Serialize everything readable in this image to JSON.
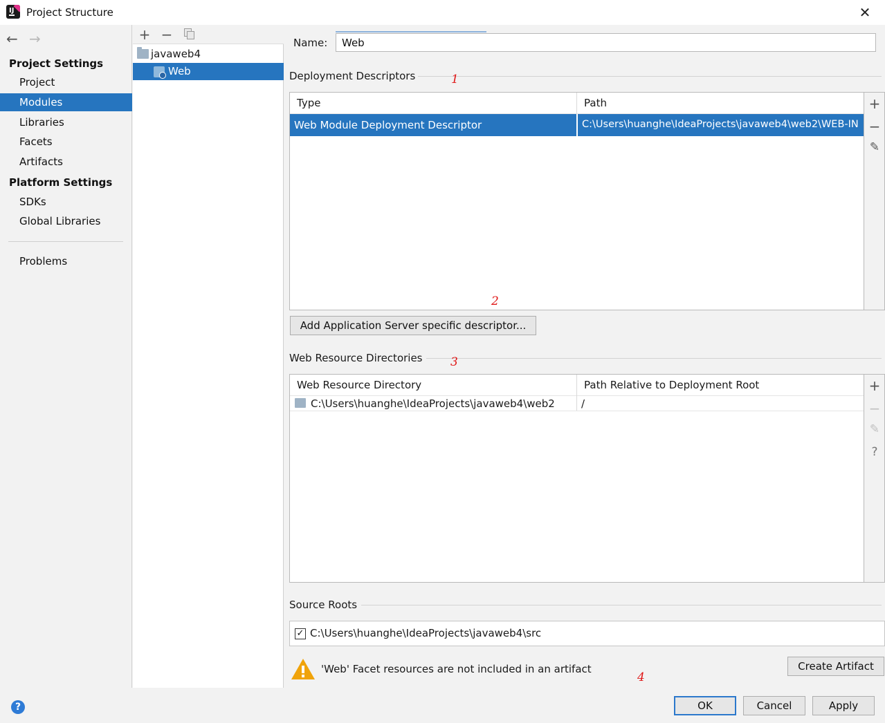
{
  "window": {
    "title": "Project Structure",
    "close_icon": "close-icon"
  },
  "nav": {
    "sections": [
      {
        "title": "Project Settings",
        "items": [
          "Project",
          "Modules",
          "Libraries",
          "Facets",
          "Artifacts"
        ]
      },
      {
        "title": "Platform Settings",
        "items": [
          "SDKs",
          "Global Libraries"
        ]
      }
    ],
    "bottom_item": "Problems",
    "selected": "Modules"
  },
  "tree": {
    "project": "javaweb4",
    "facet": "Web"
  },
  "name_field": {
    "label": "Name:",
    "value": "Web"
  },
  "deployment": {
    "section_title": "Deployment Descriptors",
    "columns": [
      "Type",
      "Path"
    ],
    "rows": [
      {
        "type": "Web Module Deployment Descriptor",
        "path": "C:\\Users\\huanghe\\IdeaProjects\\javaweb4\\web2\\WEB-IN"
      }
    ],
    "add_button": "Add Application Server specific descriptor..."
  },
  "web_resources": {
    "section_title": "Web Resource Directories",
    "columns": [
      "Web Resource Directory",
      "Path Relative to Deployment Root"
    ],
    "rows": [
      {
        "directory": "C:\\Users\\huanghe\\IdeaProjects\\javaweb4\\web2",
        "relative": "/"
      }
    ]
  },
  "source_roots": {
    "section_title": "Source Roots",
    "items": [
      {
        "checked": true,
        "path": "C:\\Users\\huanghe\\IdeaProjects\\javaweb4\\src"
      }
    ]
  },
  "warning": {
    "text": "'Web' Facet resources are not included in an artifact",
    "button": "Create Artifact"
  },
  "annotations": [
    "1",
    "2",
    "3",
    "4"
  ],
  "dialog_buttons": {
    "ok": "OK",
    "cancel": "Cancel",
    "apply": "Apply"
  },
  "colors": {
    "selection": "#2675bf",
    "annotation": "#e01818",
    "warning": "#f0a30a"
  }
}
